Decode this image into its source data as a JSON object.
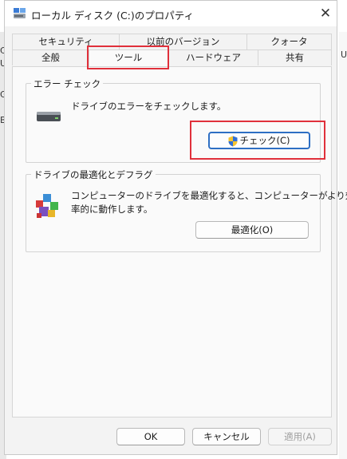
{
  "window": {
    "title": "ローカル ディスク (C:)のプロパティ",
    "close_label": "✕"
  },
  "tabs": {
    "back_row": [
      "セキュリティ",
      "以前のバージョン",
      "クォータ"
    ],
    "front_row": [
      "全般",
      "ツール",
      "ハードウェア",
      "共有"
    ],
    "active": "ツール"
  },
  "error_check": {
    "title": "エラー チェック",
    "description": "ドライブのエラーをチェックします。",
    "button_label": "チェック(C)"
  },
  "optimize": {
    "title": "ドライブの最適化とデフラグ",
    "description_line1": "コンピューターのドライブを最適化すると、コンピューターがより効",
    "description_line2": "率的に動作します。",
    "button_label": "最適化(O)"
  },
  "footer": {
    "ok_label": "OK",
    "cancel_label": "キャンセル",
    "apply_label": "適用(A)"
  },
  "background": {
    "left_fragments": [
      "C",
      "U",
      "G",
      "B"
    ],
    "right_fragment": "U"
  },
  "colors": {
    "highlight": "#e0303b",
    "accent": "#2e6fc4"
  }
}
